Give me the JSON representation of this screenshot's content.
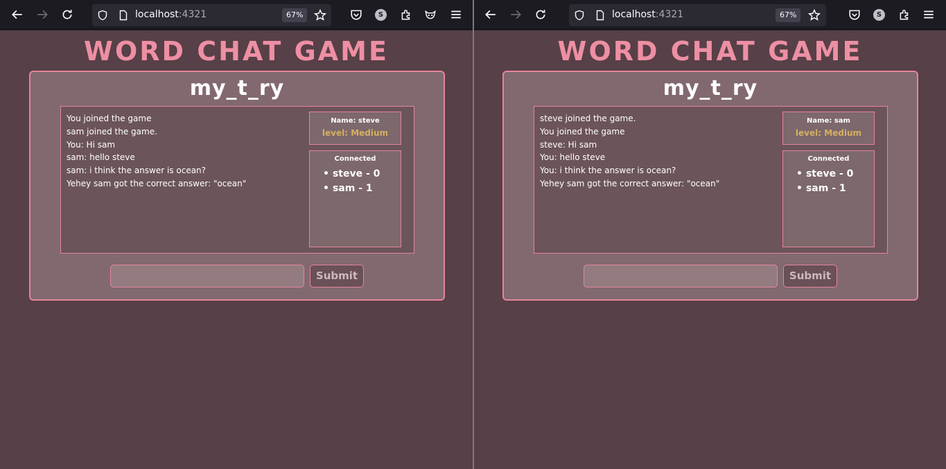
{
  "windows": [
    {
      "browser": {
        "host": "localhost",
        "port": ":4321",
        "zoom": "67%"
      },
      "app": {
        "title": "WORD CHAT GAME",
        "room": "my_t_ry",
        "messages": [
          "You joined the game",
          "sam joined the game.",
          "You: Hi sam",
          "sam: hello steve",
          "sam: i think the answer is ocean?",
          "Yehey sam got the correct answer: \"ocean\""
        ],
        "name_label": "Name: steve",
        "level_label": "level: Medium",
        "connected_title": "Connected",
        "players": [
          "steve - 0",
          "sam - 1"
        ],
        "input_placeholder": "",
        "submit_label": "Submit"
      }
    },
    {
      "browser": {
        "host": "localhost",
        "port": ":4321",
        "zoom": "67%"
      },
      "app": {
        "title": "WORD CHAT GAME",
        "room": "my_t_ry",
        "messages": [
          "steve joined the game.",
          "You joined the game",
          "steve: Hi sam",
          "You: hello steve",
          "You: i think the answer is ocean?",
          "Yehey sam got the correct answer: \"ocean\""
        ],
        "name_label": "Name: sam",
        "level_label": "level: Medium",
        "connected_title": "Connected",
        "players": [
          "steve - 0",
          "sam - 1"
        ],
        "input_placeholder": "",
        "submit_label": "Submit"
      }
    }
  ],
  "icons": {
    "profile_avatar_letter": "S",
    "nav": [
      "back-arrow-icon",
      "forward-arrow-icon",
      "reload-icon"
    ],
    "toolbar": [
      "pocket-icon",
      "profile-avatar",
      "extensions-icon",
      "menu-icon"
    ]
  },
  "colors": {
    "page_bg": "#574047",
    "card_bg": "#826970",
    "accent_pink": "#ee8fa4",
    "level_gold": "#d4b060"
  }
}
